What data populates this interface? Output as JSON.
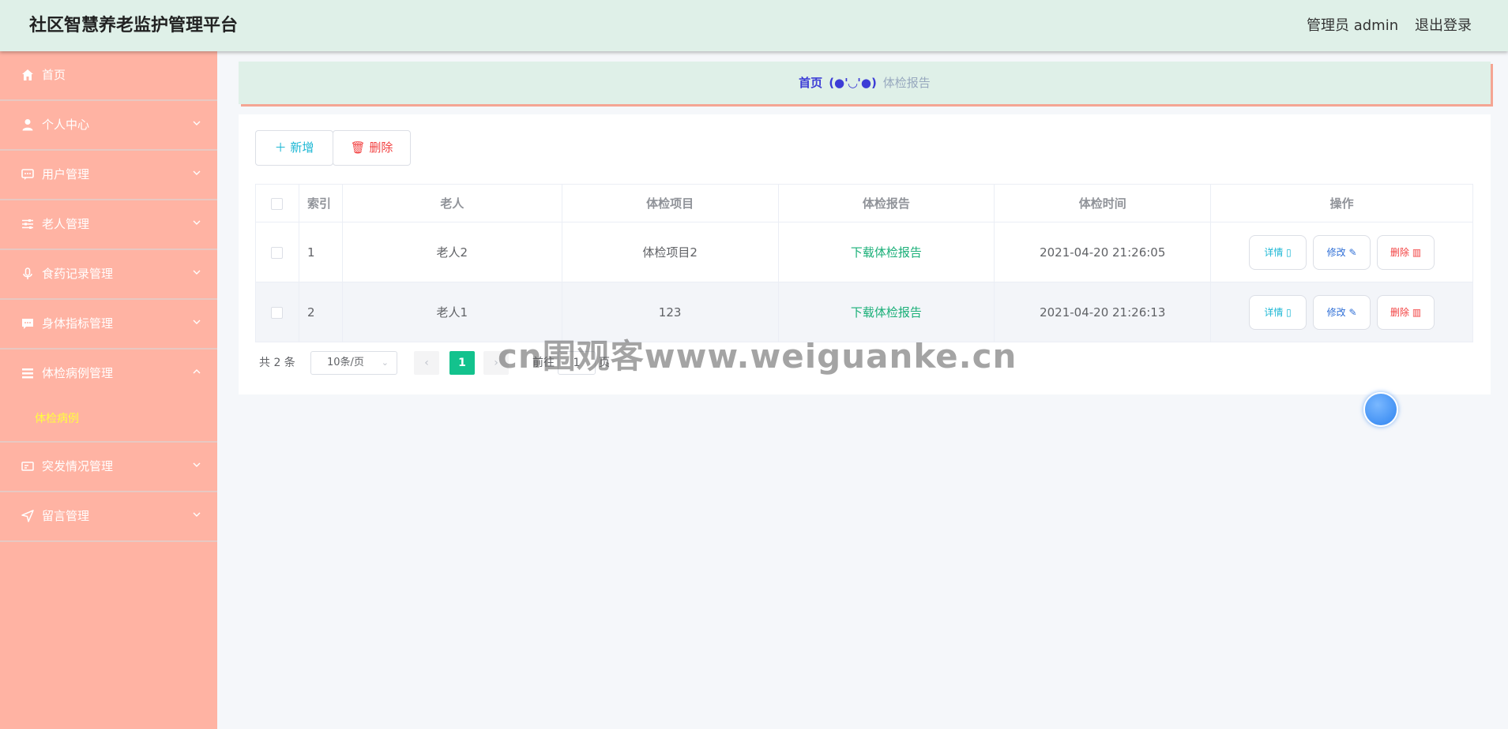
{
  "header": {
    "title": "社区智慧养老监护管理平台",
    "user": "管理员 admin",
    "logout": "退出登录"
  },
  "sidebar": {
    "items": [
      {
        "label": "首页",
        "icon": "home-icon"
      },
      {
        "label": "个人中心",
        "icon": "user-icon"
      },
      {
        "label": "用户管理",
        "icon": "chat-icon"
      },
      {
        "label": "老人管理",
        "icon": "sliders-icon"
      },
      {
        "label": "食药记录管理",
        "icon": "mic-icon"
      },
      {
        "label": "身体指标管理",
        "icon": "message-icon"
      },
      {
        "label": "体检病例管理",
        "icon": "list-icon",
        "sub": "体检病例"
      },
      {
        "label": "突发情况管理",
        "icon": "card-icon"
      },
      {
        "label": "留言管理",
        "icon": "send-icon"
      }
    ]
  },
  "breadcrumb": {
    "home": "首页",
    "sep": "(●'◡'●)",
    "current": "体检报告"
  },
  "toolbar": {
    "add": "新增",
    "delete": "删除"
  },
  "table": {
    "headers": [
      "索引",
      "老人",
      "体检项目",
      "体检报告",
      "体检时间",
      "操作"
    ],
    "rows": [
      {
        "index": "1",
        "elder": "老人2",
        "item": "体检项目2",
        "report": "下载体检报告",
        "time": "2021-04-20 21:26:05"
      },
      {
        "index": "2",
        "elder": "老人1",
        "item": "123",
        "report": "下载体检报告",
        "time": "2021-04-20 21:26:13"
      }
    ],
    "actions": {
      "detail": "详情",
      "edit": "修改",
      "delete": "删除"
    }
  },
  "pagination": {
    "total": "共 2 条",
    "page_size": "10条/页",
    "current_page": "1",
    "goto_prefix": "前往",
    "goto_value": "1",
    "goto_suffix": "页"
  },
  "watermark": "cn围观客www.weiguanke.cn",
  "colors": {
    "header_bg": "#dff0e8",
    "sidebar_bg": "#ffb3a3",
    "accent": "#13c28d",
    "link": "#1aaf78"
  }
}
